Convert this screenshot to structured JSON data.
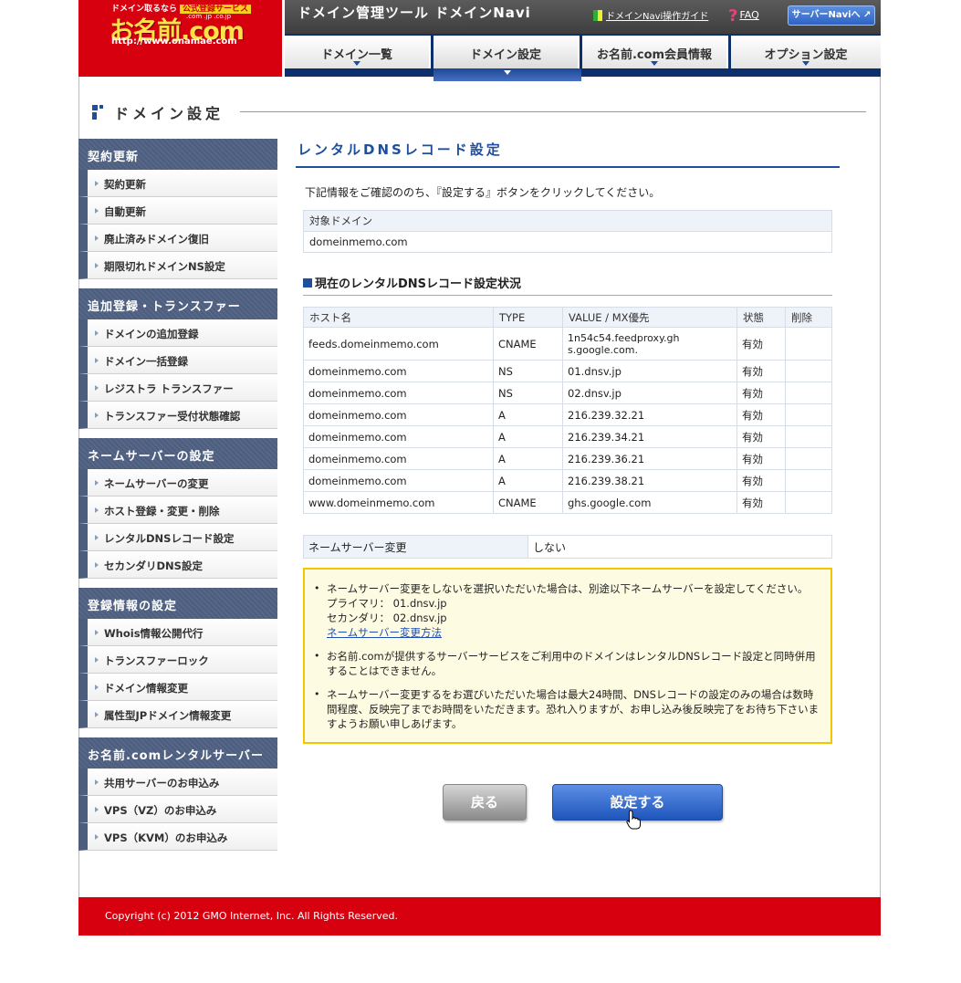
{
  "logo": {
    "tagline": "ドメイン取るなら",
    "badge": "公式登録サービス",
    "brand": "お名前.com",
    "tlds": ".com .jp .co.jp",
    "url": "http://www.onamae.com"
  },
  "topbar": {
    "tool_title": "ドメイン管理ツール ドメインNavi",
    "guide": "ドメインNavi操作ガイド",
    "faq": "FAQ",
    "server_navi": "サーバーNaviへ ↗"
  },
  "global_nav": [
    "ドメイン一覧",
    "ドメイン設定",
    "お名前.com会員情報",
    "オプション設定"
  ],
  "page_heading": "ドメイン設定",
  "sidebar": [
    {
      "title": "契約更新",
      "items": [
        "契約更新",
        "自動更新",
        "廃止済みドメイン復旧",
        "期限切れドメインNS設定"
      ]
    },
    {
      "title": "追加登録・トランスファー",
      "items": [
        "ドメインの追加登録",
        "ドメイン一括登録",
        "レジストラ トランスファー",
        "トランスファー受付状態確認"
      ]
    },
    {
      "title": "ネームサーバーの設定",
      "items": [
        "ネームサーバーの変更",
        "ホスト登録・変更・削除",
        "レンタルDNSレコード設定",
        "セカンダリDNS設定"
      ]
    },
    {
      "title": "登録情報の設定",
      "items": [
        "Whois情報公開代行",
        "トランスファーロック",
        "ドメイン情報変更",
        "属性型JPドメイン情報変更"
      ]
    },
    {
      "title": "お名前.comレンタルサーバー",
      "items": [
        "共用サーバーのお申込み",
        "VPS（VZ）のお申込み",
        "VPS（KVM）のお申込み"
      ]
    }
  ],
  "main": {
    "section_title": "レンタルDNSレコード設定",
    "intro": "下記情報をご確認ののち、『設定する』ボタンをクリックしてください。",
    "target": {
      "label": "対象ドメイン",
      "value": "domeinmemo.com"
    },
    "current_title": "現在のレンタルDNSレコード設定状況",
    "dns_headers": [
      "ホスト名",
      "TYPE",
      "VALUE / MX優先",
      "状態",
      "削除"
    ],
    "dns_rows": [
      {
        "host": "feeds.domeinmemo.com",
        "type": "CNAME",
        "value": "1n54c54.feedproxy.gh s.google.com.",
        "status": "有効",
        "delete": ""
      },
      {
        "host": "domeinmemo.com",
        "type": "NS",
        "value": "01.dnsv.jp",
        "status": "有効",
        "delete": ""
      },
      {
        "host": "domeinmemo.com",
        "type": "NS",
        "value": "02.dnsv.jp",
        "status": "有効",
        "delete": ""
      },
      {
        "host": "domeinmemo.com",
        "type": "A",
        "value": "216.239.32.21",
        "status": "有効",
        "delete": ""
      },
      {
        "host": "domeinmemo.com",
        "type": "A",
        "value": "216.239.34.21",
        "status": "有効",
        "delete": ""
      },
      {
        "host": "domeinmemo.com",
        "type": "A",
        "value": "216.239.36.21",
        "status": "有効",
        "delete": ""
      },
      {
        "host": "domeinmemo.com",
        "type": "A",
        "value": "216.239.38.21",
        "status": "有効",
        "delete": ""
      },
      {
        "host": "www.domeinmemo.com",
        "type": "CNAME",
        "value": "ghs.google.com",
        "status": "有効",
        "delete": ""
      }
    ],
    "ns_change": {
      "label": "ネームサーバー変更",
      "value": "しない"
    },
    "notice": {
      "item1": "ネームサーバー変更をしないを選択いただいた場合は、別途以下ネームサーバーを設定してください。",
      "primary": "プライマリ： 01.dnsv.jp",
      "secondary": "セカンダリ： 02.dnsv.jp",
      "link": "ネームサーバー変更方法",
      "item2": "お名前.comが提供するサーバーサービスをご利用中のドメインはレンタルDNSレコード設定と同時併用することはできません。",
      "item3": "ネームサーバー変更するをお選びいただいた場合は最大24時間、DNSレコードの設定のみの場合は数時間程度、反映完了までお時間をいただきます。恐れ入りますが、お申し込み後反映完了をお待ち下さいますようお願い申しあげます。"
    },
    "back_label": "戻る",
    "submit_label": "設定する"
  },
  "footer": "Copyright (c) 2012 GMO Internet, Inc. All Rights Reserved."
}
